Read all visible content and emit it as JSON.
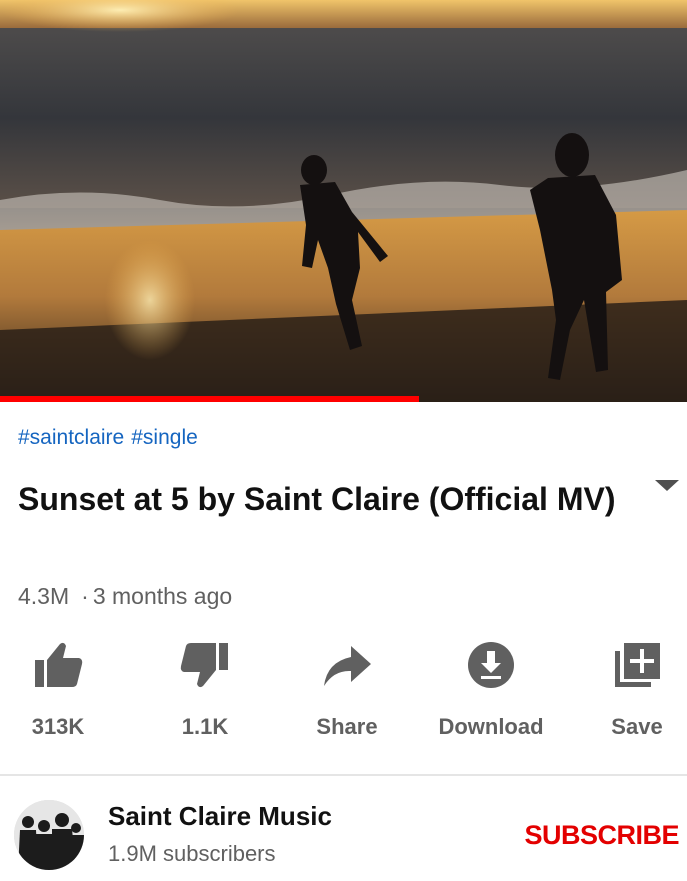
{
  "video": {
    "progress_fraction": 0.61,
    "progress_color": "#ff0000"
  },
  "hashtags": [
    "#saintclaire",
    "#single"
  ],
  "title": "Sunset at 5 by Saint Claire (Official MV)",
  "meta": {
    "views": "4.3M",
    "separator": "·",
    "age": "3 months ago"
  },
  "actions": [
    {
      "icon": "thumbs-up-icon",
      "label": "313K"
    },
    {
      "icon": "thumbs-down-icon",
      "label": "1.1K"
    },
    {
      "icon": "share-icon",
      "label": "Share"
    },
    {
      "icon": "download-icon",
      "label": "Download"
    },
    {
      "icon": "add-to-playlist-icon",
      "label": "Save"
    }
  ],
  "channel": {
    "name": "Saint Claire Music",
    "subscribers": "1.9M subscribers",
    "subscribe_label": "SUBSCRIBE",
    "subscribe_color": "#e30000"
  }
}
